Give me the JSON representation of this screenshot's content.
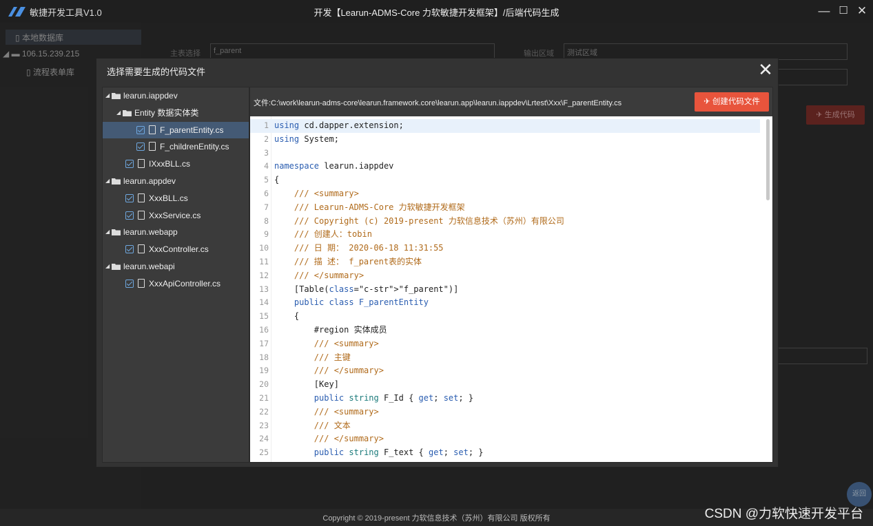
{
  "app": {
    "name": "敏捷开发工具V1.0",
    "title": "开发【Learun-ADMS-Core 力软敏捷开发框架】/后端代码生成",
    "footer": "Copyright © 2019-present 力软信息技术（苏州）有限公司 版权所有",
    "watermark": "CSDN @力软快速开发平台",
    "back_label": "返回",
    "brand_color": "#4a90e2"
  },
  "window_controls": {
    "minimize": "—",
    "maximize": "☐",
    "close": "✕"
  },
  "background": {
    "sidebar": [
      "本地数据库",
      "106.15.239.215",
      "流程表单库"
    ],
    "main_table_label": "主表选择",
    "main_table_value": "f_parent",
    "output_label": "输出区域",
    "output_value": "测试区域",
    "generate_label": "生成代码"
  },
  "dialog": {
    "title": "选择需要生成的代码文件",
    "close": "✕",
    "path": "文件:C:\\work\\learun-adms-core\\learun.framework.core\\learun.app\\learun.iappdev\\Lrtest\\Xxx\\F_parentEntity.cs",
    "create_button": "创建代码文件",
    "create_color": "#e8543c",
    "tree": [
      {
        "label": "learun.iappdev",
        "kind": "folder",
        "indent": 0
      },
      {
        "label": "Entity 数据实体类",
        "kind": "folder",
        "indent": 1
      },
      {
        "label": "F_parentEntity.cs",
        "kind": "file",
        "indent": 2,
        "selected": true
      },
      {
        "label": "F_childrenEntity.cs",
        "kind": "file",
        "indent": 2
      },
      {
        "label": "IXxxBLL.cs",
        "kind": "file",
        "indent": 1
      },
      {
        "label": "learun.appdev",
        "kind": "folder",
        "indent": 0
      },
      {
        "label": "XxxBLL.cs",
        "kind": "file",
        "indent": 1
      },
      {
        "label": "XxxService.cs",
        "kind": "file",
        "indent": 1
      },
      {
        "label": "learun.webapp",
        "kind": "folder",
        "indent": 0
      },
      {
        "label": "XxxController.cs",
        "kind": "file",
        "indent": 1
      },
      {
        "label": "learun.webapi",
        "kind": "folder",
        "indent": 0
      },
      {
        "label": "XxxApiController.cs",
        "kind": "file",
        "indent": 1
      }
    ],
    "code_lines": [
      "using cd.dapper.extension;",
      "using System;",
      "",
      "namespace learun.iappdev",
      "{",
      "    /// <summary>",
      "    /// Learun-ADMS-Core 力软敏捷开发框架",
      "    /// Copyright (c) 2019-present 力软信息技术（苏州）有限公司",
      "    /// 创建人：tobin",
      "    /// 日 期： 2020-06-18 11:31:55",
      "    /// 描 述： f_parent表的实体",
      "    /// </summary>",
      "    [Table(\"f_parent\")]",
      "    public class F_parentEntity",
      "    {",
      "        #region 实体成员",
      "        /// <summary>",
      "        /// 主键",
      "        /// </summary>",
      "        [Key]",
      "        public string F_Id { get; set; }",
      "        /// <summary>",
      "        /// 文本",
      "        /// </summary>",
      "        public string F_text { get; set; }"
    ]
  }
}
